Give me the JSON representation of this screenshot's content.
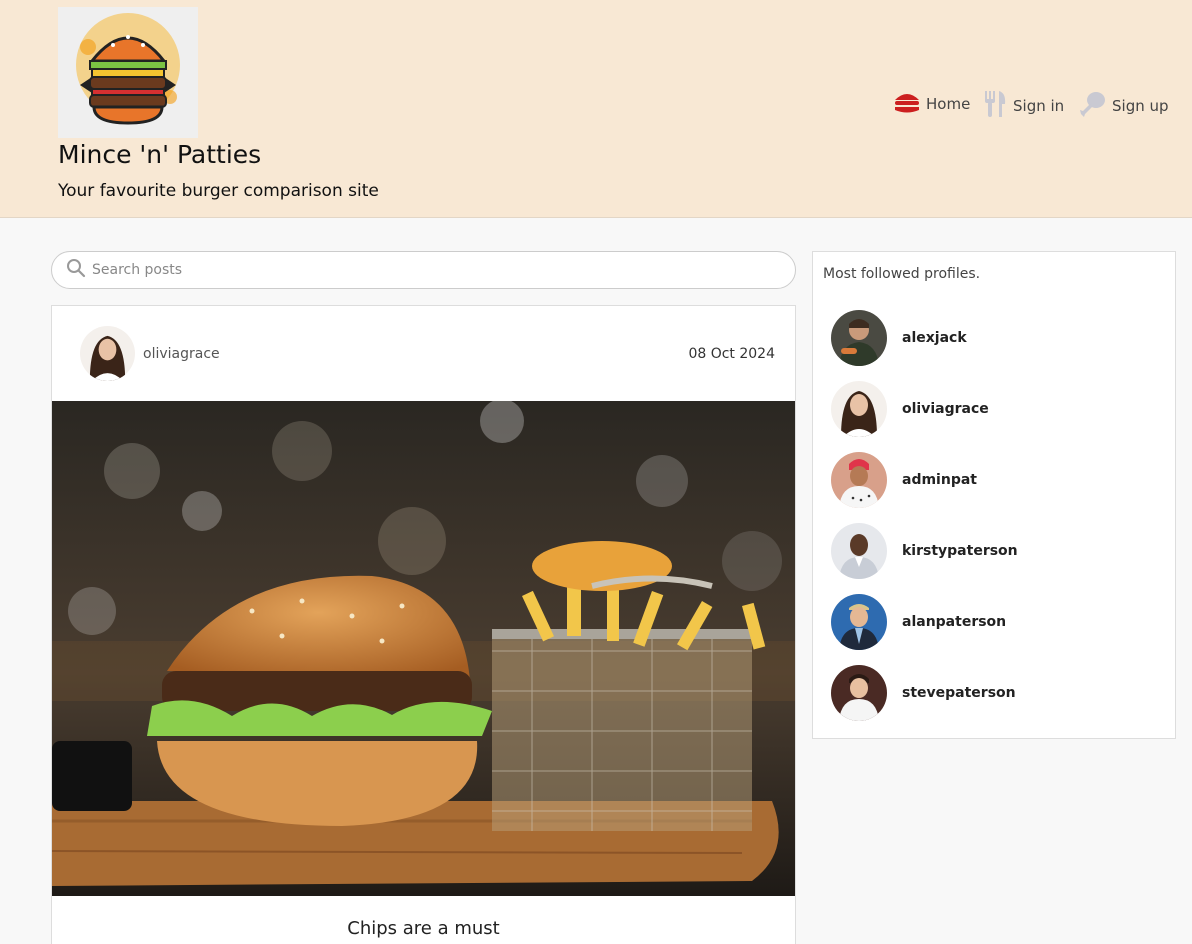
{
  "header": {
    "site_title": "Mince 'n' Patties",
    "tagline": "Your favourite burger comparison site",
    "nav": {
      "home": "Home",
      "sign_in": "Sign in",
      "sign_up": "Sign up"
    }
  },
  "search": {
    "placeholder": "Search posts",
    "value": ""
  },
  "post": {
    "author": "oliviagrace",
    "date": "08 Oct 2024",
    "title": "Chips are a must"
  },
  "sidebar": {
    "heading": "Most followed profiles.",
    "profiles": [
      {
        "name": "alexjack"
      },
      {
        "name": "oliviagrace"
      },
      {
        "name": "adminpat"
      },
      {
        "name": "kirstypaterson"
      },
      {
        "name": "alanpaterson"
      },
      {
        "name": "stevepaterson"
      }
    ]
  },
  "colors": {
    "header_bg": "#f8e8d4",
    "page_bg": "#f8f8f8",
    "burger_icon": "#cc1f1f",
    "nav_icon_grey": "#c9c9d2"
  }
}
